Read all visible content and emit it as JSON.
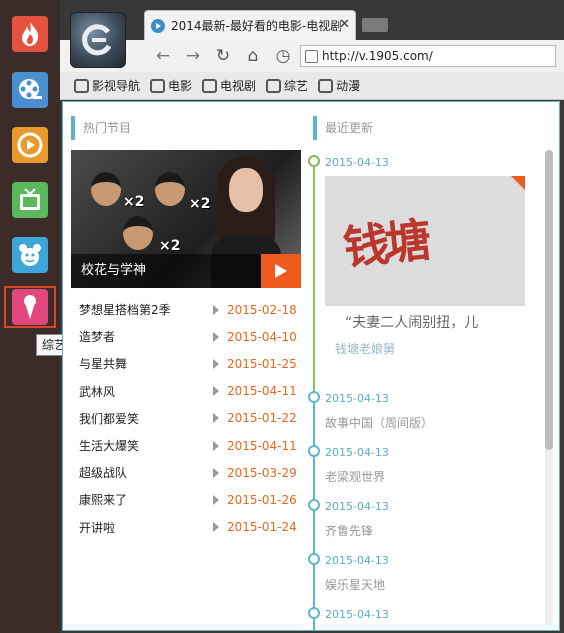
{
  "dock": {
    "items": [
      {
        "name": "fire-app",
        "color": "#e5533f"
      },
      {
        "name": "film-reel-app",
        "color": "#4a8fd0"
      },
      {
        "name": "play-app",
        "color": "#e89a2a"
      },
      {
        "name": "tv-app",
        "color": "#5bb85d"
      },
      {
        "name": "cartoon-app",
        "color": "#3ca7d8"
      },
      {
        "name": "variety-app",
        "color": "#e3457d"
      }
    ],
    "tooltip": "综艺"
  },
  "browser": {
    "tab_title": "2014最新-最好看的电影-电视剧",
    "tab_close": "✕",
    "address": "http://v.1905.com/",
    "nav": {
      "back": "←",
      "forward": "→",
      "reload": "↻",
      "home": "⌂",
      "history": "◷"
    },
    "bookmarks": [
      "影视导航",
      "电影",
      "电视剧",
      "综艺",
      "动漫"
    ]
  },
  "hot": {
    "heading": "热门节目",
    "featured_caption": "校花与学神",
    "times": [
      "×2",
      "×2",
      "×2"
    ],
    "items": [
      {
        "title": "梦想星搭档第2季",
        "date": "2015-02-18"
      },
      {
        "title": "造梦者",
        "date": "2015-04-10"
      },
      {
        "title": "与星共舞",
        "date": "2015-01-25"
      },
      {
        "title": "武林风",
        "date": "2015-04-11"
      },
      {
        "title": "我们都爱笑",
        "date": "2015-01-22"
      },
      {
        "title": "生活大爆笑",
        "date": "2015-04-11"
      },
      {
        "title": "超级战队",
        "date": "2015-03-29"
      },
      {
        "title": "康熙来了",
        "date": "2015-01-26"
      },
      {
        "title": "开讲啦",
        "date": "2015-01-24"
      }
    ]
  },
  "recent": {
    "heading": "最近更新",
    "featured": {
      "date": "2015-04-13",
      "image_text": "钱塘",
      "quote": "“夫妻二人闹别扭，儿",
      "subtitle": "钱塘老娘舅"
    },
    "items": [
      {
        "date": "2015-04-13",
        "title": "故事中国（周间版）"
      },
      {
        "date": "2015-04-13",
        "title": "老梁观世界"
      },
      {
        "date": "2015-04-13",
        "title": "齐鲁先锋"
      },
      {
        "date": "2015-04-13",
        "title": "娱乐星天地"
      },
      {
        "date": "2015-04-13",
        "title": ""
      }
    ]
  },
  "colors": {
    "accent": "#5fb6cc",
    "date_orange": "#e76820",
    "play_orange": "#ef5a1d",
    "timeline_green": "#7fb95e"
  }
}
